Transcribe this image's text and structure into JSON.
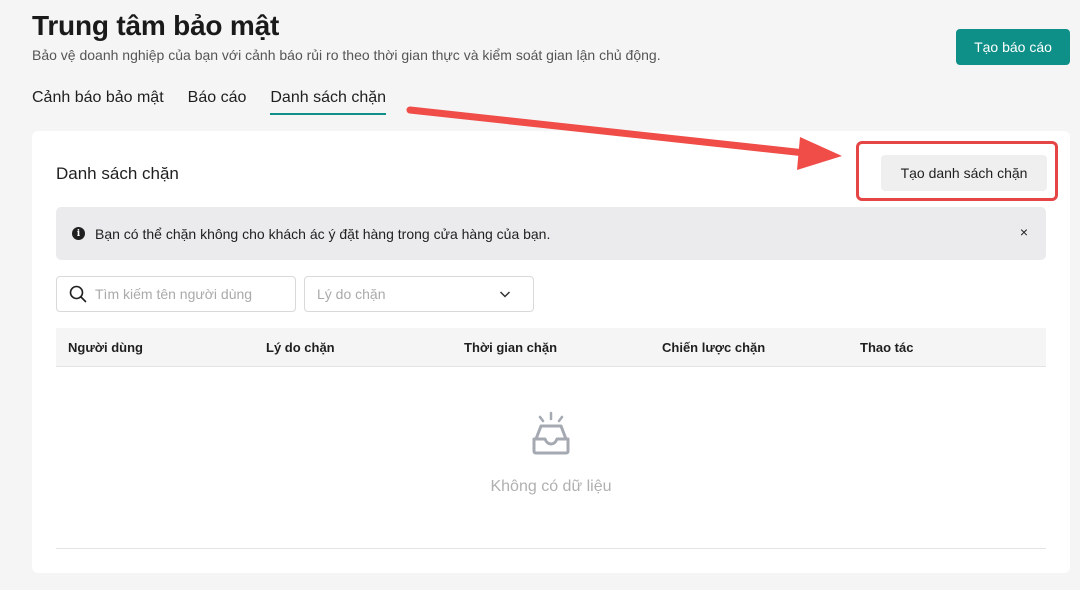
{
  "header": {
    "title": "Trung tâm bảo mật",
    "subtitle": "Bảo vệ doanh nghiệp của bạn với cảnh báo rủi ro theo thời gian thực và kiểm soát gian lận chủ động.",
    "create_report_label": "Tạo báo cáo"
  },
  "tabs": [
    {
      "label": "Cảnh báo bảo mật",
      "active": false
    },
    {
      "label": "Báo cáo",
      "active": false
    },
    {
      "label": "Danh sách chặn",
      "active": true
    }
  ],
  "card": {
    "title": "Danh sách chặn",
    "create_block_label": "Tạo danh sách chặn",
    "info_text": "Bạn có thể chặn không cho khách ác ý đặt hàng trong cửa hàng của bạn.",
    "info_icon": "info-icon",
    "close_icon_glyph": "×",
    "search_placeholder": "Tìm kiếm tên người dùng",
    "reason_placeholder": "Lý do chặn",
    "columns": [
      "Người dùng",
      "Lý do chặn",
      "Thời gian chặn",
      "Chiến lược chặn",
      "Thao tác"
    ],
    "empty_text": "Không có dữ liệu"
  },
  "colors": {
    "accent": "#0e8f88",
    "annotation": "#e64545"
  }
}
